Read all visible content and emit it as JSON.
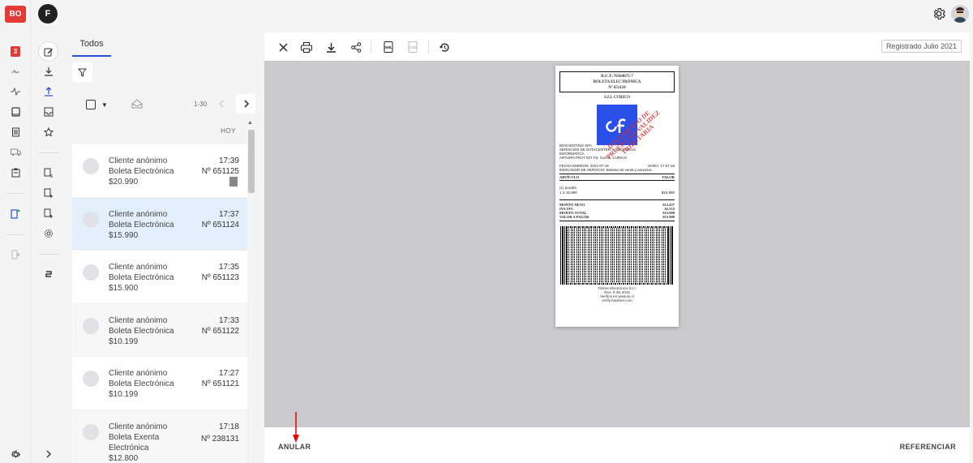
{
  "app": {
    "badge": "BO",
    "user_initial": "F",
    "accent": "#2b4fd6",
    "alert_red": "#e53935"
  },
  "rail": {
    "notification_count": "3",
    "icons": [
      "trend-icon",
      "activity-icon",
      "book-icon",
      "ledger-icon",
      "truck-icon",
      "clipboard-icon",
      "document-settings-icon",
      "exit-icon",
      "settings-icon",
      "chevron-right-icon"
    ]
  },
  "sidebar": {
    "icons": [
      "edit-icon",
      "download-icon",
      "upload-icon",
      "inbox-icon",
      "star-icon",
      "doc-dollar-icon",
      "doc-add-icon",
      "doc-add-alt-icon",
      "settings-icon",
      "connector-icon"
    ]
  },
  "list": {
    "tab_label": "Todos",
    "range": "1-30",
    "group_label": "HOY",
    "items": [
      {
        "client": "Cliente anónimo",
        "doc_type": "Boleta Electrónica",
        "doc_type_2": "",
        "amount": "$20.990",
        "time": "17:39",
        "number": "Nº 651125",
        "has_file": true
      },
      {
        "client": "Cliente anónimo",
        "doc_type": "Boleta Electrónica",
        "doc_type_2": "",
        "amount": "$15.990",
        "time": "17:37",
        "number": "Nº 651124",
        "has_file": false
      },
      {
        "client": "Cliente anónimo",
        "doc_type": "Boleta Electrónica",
        "doc_type_2": "",
        "amount": "$15.900",
        "time": "17:35",
        "number": "Nº 651123",
        "has_file": false
      },
      {
        "client": "Cliente anónimo",
        "doc_type": "Boleta Electrónica",
        "doc_type_2": "",
        "amount": "$10.199",
        "time": "17:33",
        "number": "Nº 651122",
        "has_file": false
      },
      {
        "client": "Cliente anónimo",
        "doc_type": "Boleta Electrónica",
        "doc_type_2": "",
        "amount": "$10.199",
        "time": "17:27",
        "number": "Nº 651121",
        "has_file": false
      },
      {
        "client": "Cliente anónimo",
        "doc_type": "Boleta Exenta",
        "doc_type_2": "Electrónica",
        "amount": "$12.800",
        "time": "17:18",
        "number": "Nº 238131",
        "has_file": false
      }
    ]
  },
  "viewer": {
    "registered_label": "Registrado Julio 2021",
    "toolbar_icons": [
      "close-icon",
      "print-icon",
      "download-icon",
      "share-icon",
      "xml-icon",
      "ced-icon",
      "history-icon"
    ],
    "xml_label": "XML",
    "ced_label": "CED",
    "footer": {
      "void_label": "ANULAR",
      "reference_label": "REFERENCIAR"
    }
  },
  "receipt": {
    "rut": "R.U.T.:76364675-7",
    "doc_title": "BOLETA ELECTRÓNICA",
    "doc_number": "Nº 651124",
    "sii": "S.I.I. CURICO",
    "company": "BOXHOSTING SPA",
    "activity_1": "SERVICIOS DE DATACENTER Y ASESORIAS",
    "activity_2": "INFORMATICA",
    "address": "ARTURO PRAT 527 P3, Curicó, CURICO",
    "date_label": "FECHA EMISION: 2021-07-15",
    "hour_label": "HORA: 17:37:18",
    "service_label": "INDICADOR DE SERVICIO: Boletas de venta y servicios",
    "col_article": "ARTÍCULO",
    "col_value": "VALOR",
    "line_item_1": "(1) prueba",
    "line_item_2": "1 X 15.990",
    "line_item_value": "$15.990",
    "totals": [
      {
        "label": "MONTO NETO",
        "value": "$13.437"
      },
      {
        "label": "IVA 19%",
        "value": "$2.553"
      },
      {
        "label": "MONTO TOTAL",
        "value": "$15.990"
      },
      {
        "label": "VALOR A PAGAR",
        "value": "$15.990"
      }
    ],
    "stamp_1": "DOCUMENTO DE",
    "stamp_2": "PRUEBA SIN VALIDEZ",
    "stamp_3": "TRIBUTARIA",
    "foot_1": "Timbre Electrónico S.I.I.",
    "foot_2": "Res. 0 del 2016",
    "foot_3": "Verifica en www.sii.cl",
    "foot_4": "verify.haulmer.com"
  }
}
